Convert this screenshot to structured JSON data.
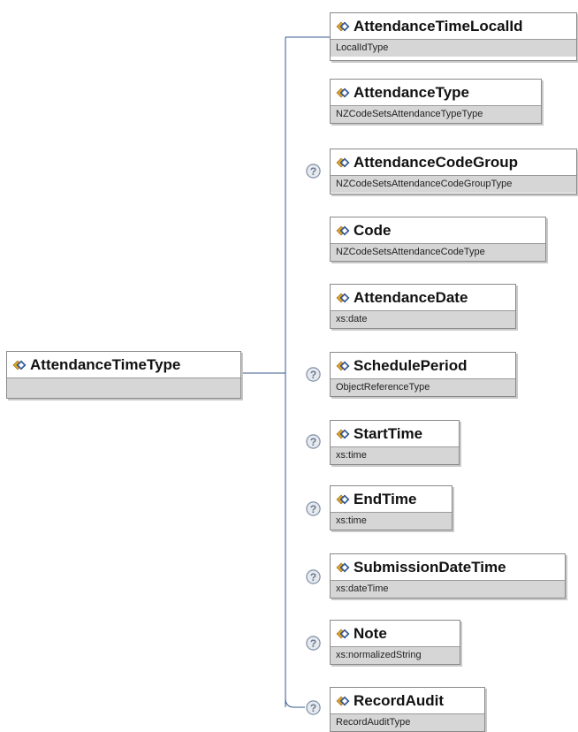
{
  "root": {
    "name": "AttendanceTimeType",
    "type": ""
  },
  "elements": [
    {
      "name": "AttendanceTimeLocalId",
      "type": "LocalIdType",
      "optional": false
    },
    {
      "name": "AttendanceType",
      "type": "NZCodeSetsAttendanceTypeType",
      "optional": false
    },
    {
      "name": "AttendanceCodeGroup",
      "type": "NZCodeSetsAttendanceCodeGroupType",
      "optional": true
    },
    {
      "name": "Code",
      "type": "NZCodeSetsAttendanceCodeType",
      "optional": false
    },
    {
      "name": "AttendanceDate",
      "type": "xs:date",
      "optional": false
    },
    {
      "name": "SchedulePeriod",
      "type": "ObjectReferenceType",
      "optional": true
    },
    {
      "name": "StartTime",
      "type": "xs:time",
      "optional": true
    },
    {
      "name": "EndTime",
      "type": "xs:time",
      "optional": true
    },
    {
      "name": "SubmissionDateTime",
      "type": "xs:dateTime",
      "optional": true
    },
    {
      "name": "Note",
      "type": "xs:normalizedString",
      "optional": true
    },
    {
      "name": "RecordAudit",
      "type": "RecordAuditType",
      "optional": true
    }
  ],
  "colors": {
    "connector": "#3b5a8c",
    "icon_gold": "#e2a52a",
    "icon_blue": "#3a63a8",
    "question_mark": "#7e8fa6"
  },
  "icons": {
    "element": "element-diamond-icon",
    "optional": "question-mark-icon"
  }
}
